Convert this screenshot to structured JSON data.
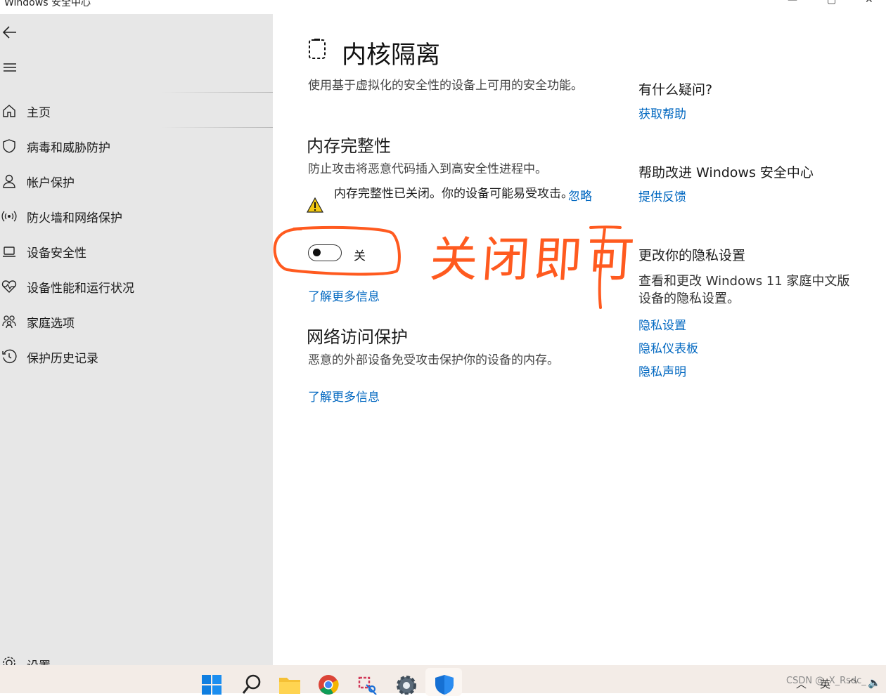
{
  "window": {
    "title": "Windows 安全中心"
  },
  "sidebar": {
    "items": [
      {
        "label": "主页"
      },
      {
        "label": "病毒和威胁防护"
      },
      {
        "label": "帐户保护"
      },
      {
        "label": "防火墙和网络保护"
      },
      {
        "label": "设备安全性"
      },
      {
        "label": "设备性能和运行状况"
      },
      {
        "label": "家庭选项"
      },
      {
        "label": "保护历史记录"
      }
    ],
    "settings_label": "设置"
  },
  "main": {
    "title": "内核隔离",
    "description": "使用基于虚拟化的安全性的设备上可用的安全功能。",
    "memory_integrity": {
      "heading": "内存完整性",
      "description": "防止攻击将恶意代码插入到高安全性进程中。",
      "warning": "内存完整性已关闭。你的设备可能易受攻击。",
      "dismiss_label": "忽略",
      "toggle_state": "关",
      "toggle_on": false,
      "learn_more": "了解更多信息"
    },
    "network_access": {
      "heading": "网络访问保护",
      "description": "恶意的外部设备免受攻击保护你的设备的内存。",
      "learn_more": "了解更多信息"
    }
  },
  "right_panel": {
    "help_heading": "有什么疑问?",
    "help_link": "获取帮助",
    "improve_heading": "帮助改进 Windows 安全中心",
    "feedback_link": "提供反馈",
    "privacy_heading": "更改你的隐私设置",
    "privacy_text": "查看和更改 Windows 11 家庭中文版设备的隐私设置。",
    "privacy_links": [
      "隐私设置",
      "隐私仪表板",
      "隐私声明"
    ]
  },
  "annotation": {
    "text": "关闭即可",
    "color": "#ff5a1f"
  },
  "taskbar": {
    "apps": [
      "windows-start-icon",
      "search-icon",
      "file-explorer-icon",
      "chrome-icon",
      "snipping-tool-icon",
      "settings-gear-icon",
      "windows-security-shield-icon"
    ],
    "tray_language": "英",
    "watermark": "CSDN @_X_Rsdc_"
  },
  "colors": {
    "accent": "#0067c0",
    "warning": "#f2c811",
    "sidebar_bg": "#e7e7e7",
    "taskbar_bg": "#f3ece7"
  }
}
